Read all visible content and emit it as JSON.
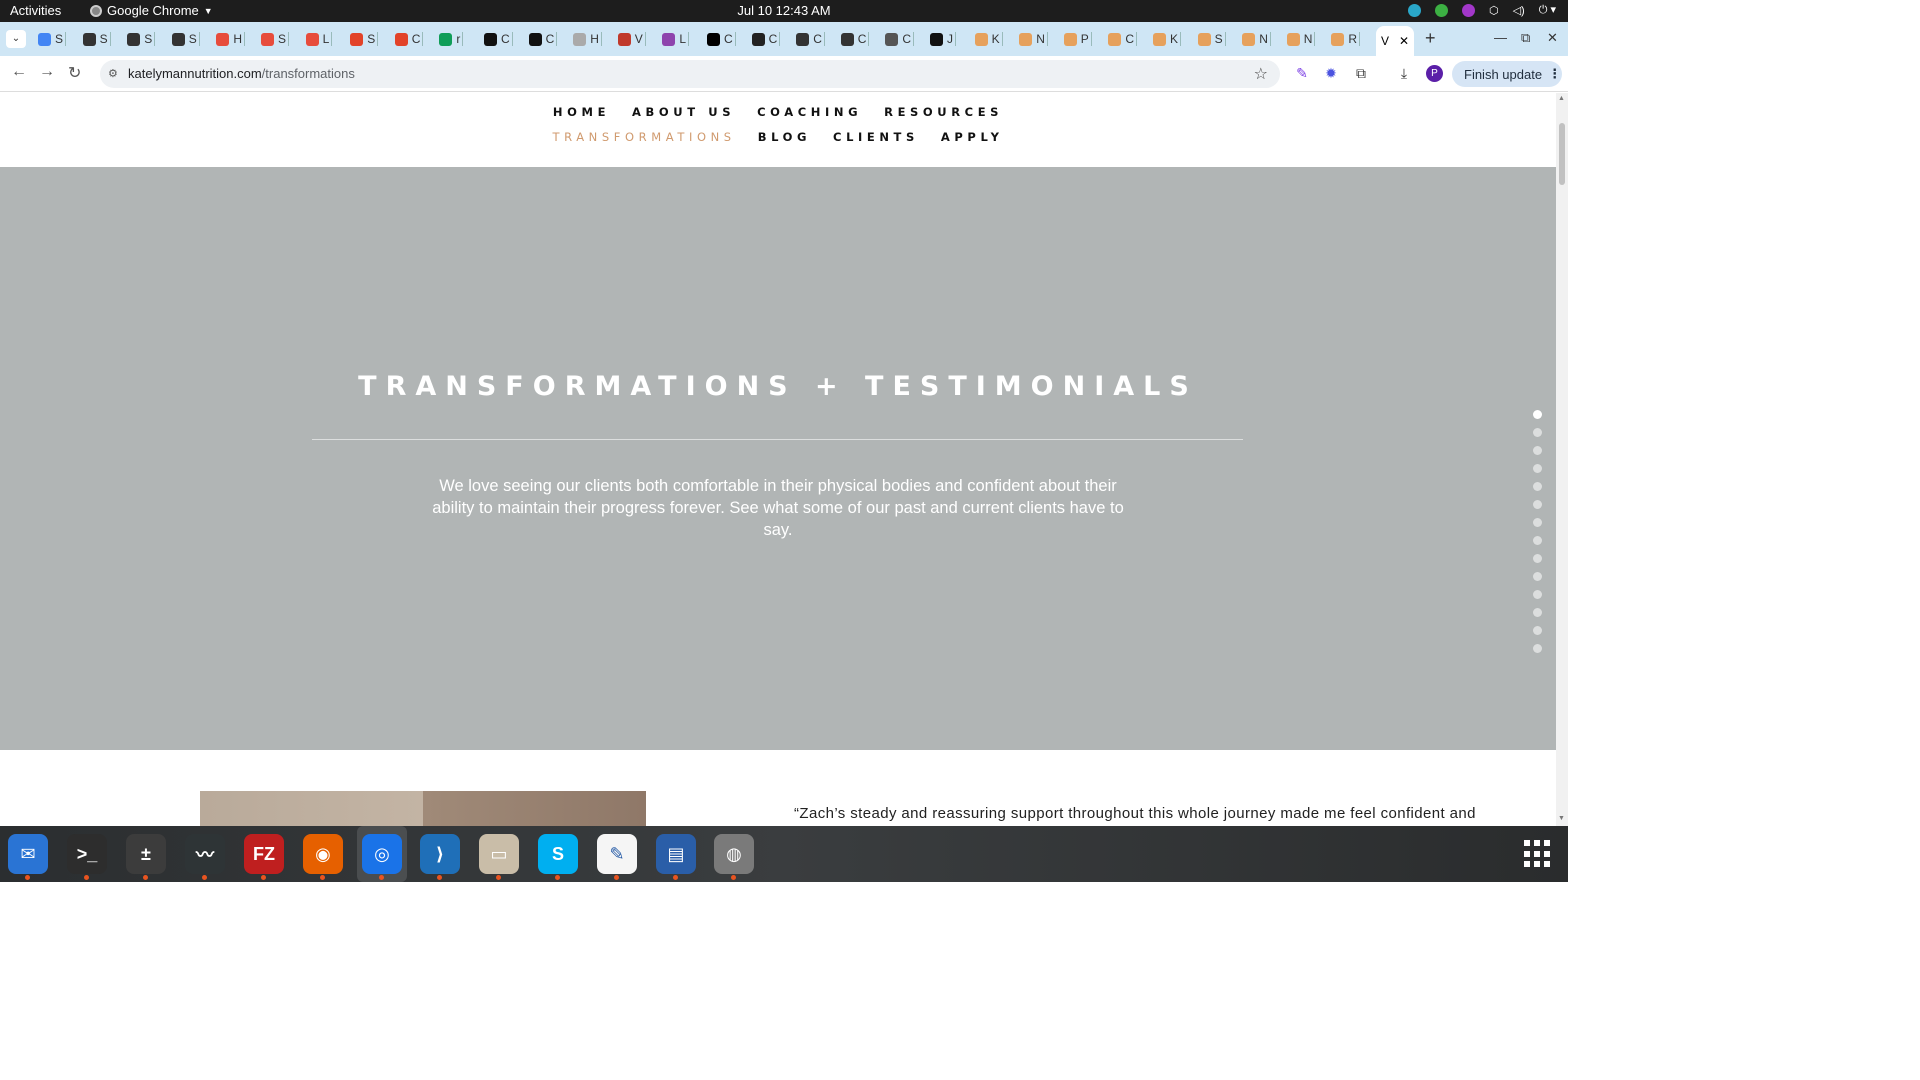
{
  "system": {
    "activities": "Activities",
    "app_name": "Google Chrome",
    "clock": "Jul 10  12:43 AM"
  },
  "browser": {
    "tabs": [
      {
        "label": "S",
        "color": "#4285f4"
      },
      {
        "label": "S",
        "color": "#333333"
      },
      {
        "label": "S",
        "color": "#333333"
      },
      {
        "label": "S",
        "color": "#333333"
      },
      {
        "label": "H",
        "color": "#e74c3c"
      },
      {
        "label": "S",
        "color": "#e74c3c"
      },
      {
        "label": "L",
        "color": "#e74c3c"
      },
      {
        "label": "S",
        "color": "#e24329"
      },
      {
        "label": "C",
        "color": "#e24329"
      },
      {
        "label": "r",
        "color": "#0f9d58"
      },
      {
        "label": "C",
        "color": "#111111"
      },
      {
        "label": "C",
        "color": "#111111"
      },
      {
        "label": "H",
        "color": "#aaaaaa"
      },
      {
        "label": "V",
        "color": "#c0392b"
      },
      {
        "label": "L",
        "color": "#8e44ad"
      },
      {
        "label": "C",
        "color": "#000000"
      },
      {
        "label": "C",
        "color": "#222222"
      },
      {
        "label": "C",
        "color": "#333333"
      },
      {
        "label": "C",
        "color": "#333333"
      },
      {
        "label": "C",
        "color": "#555555"
      },
      {
        "label": "J",
        "color": "#111111"
      },
      {
        "label": "K",
        "color": "#e6a15c"
      },
      {
        "label": "N",
        "color": "#e6a15c"
      },
      {
        "label": "P",
        "color": "#e6a15c"
      },
      {
        "label": "C",
        "color": "#e6a15c"
      },
      {
        "label": "K",
        "color": "#e6a15c"
      },
      {
        "label": "S",
        "color": "#e6a15c"
      },
      {
        "label": "N",
        "color": "#e6a15c"
      },
      {
        "label": "N",
        "color": "#e6a15c"
      },
      {
        "label": "R",
        "color": "#e6a15c"
      }
    ],
    "active_tab_label": "V",
    "url_domain": "katelymannutrition.com",
    "url_path": "/transformations",
    "profile_initial": "P",
    "finish_update": "Finish update"
  },
  "site": {
    "nav_row1": [
      "HOME",
      "ABOUT US",
      "COACHING",
      "RESOURCES"
    ],
    "nav_row2": [
      "TRANSFORMATIONS",
      "BLOG",
      "CLIENTS",
      "APPLY"
    ],
    "active_nav": "TRANSFORMATIONS",
    "accent_color": "#d09a6e",
    "hero_bg": "#b1b5b5",
    "hero": {
      "title": "TRANSFORMATIONS + TESTIMONIALS",
      "text": "We love seeing our clients both comfortable in their physical bodies and confident about their ability to maintain their progress forever. See what some of our past and current clients have to say."
    },
    "section_dots_count": 14,
    "active_dot_index": 0,
    "quote_text": "“Zach’s steady and reassuring support throughout this whole journey made me feel confident and"
  },
  "dock": [
    {
      "name": "thunderbird",
      "color": "#2a74d4",
      "glyph": "✉"
    },
    {
      "name": "terminal",
      "color": "#2d2d2d",
      "glyph": ">_"
    },
    {
      "name": "calculator",
      "color": "#3c3c3c",
      "glyph": "±"
    },
    {
      "name": "system-monitor",
      "color": "#2e3436",
      "glyph": "〰"
    },
    {
      "name": "filezilla",
      "color": "#bf1f1f",
      "glyph": "FZ"
    },
    {
      "name": "firefox",
      "color": "#e66000",
      "glyph": "◉"
    },
    {
      "name": "chrome",
      "color": "#1a73e8",
      "glyph": "◎"
    },
    {
      "name": "vscode",
      "color": "#1f6fb8",
      "glyph": "⟩"
    },
    {
      "name": "files",
      "color": "#c9bda8",
      "glyph": "▭"
    },
    {
      "name": "skype",
      "color": "#00aff0",
      "glyph": "S"
    },
    {
      "name": "text-editor",
      "color": "#f5f5f5",
      "glyph": "✎"
    },
    {
      "name": "libreoffice-writer",
      "color": "#2a5ea8",
      "glyph": "▤"
    },
    {
      "name": "disk-utility",
      "color": "#7a7a7a",
      "glyph": "◍"
    }
  ]
}
